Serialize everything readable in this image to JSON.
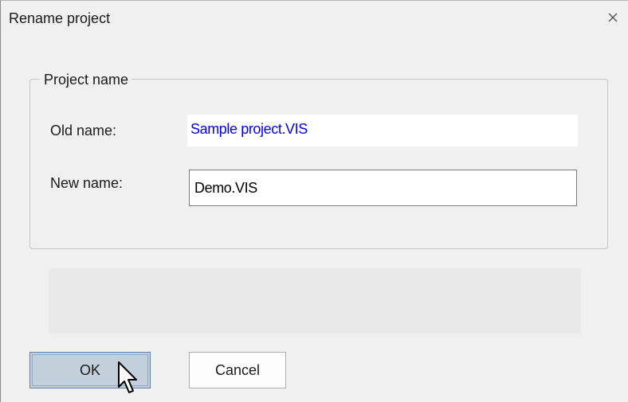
{
  "window": {
    "title": "Rename project",
    "close_glyph": "×"
  },
  "group": {
    "legend": "Project name",
    "old_name_label": "Old name:",
    "old_name_value": "Sample project.VIS",
    "new_name_label": "New name:",
    "new_name_value": "Demo.VIS"
  },
  "message_panel": {
    "text": ""
  },
  "buttons": {
    "ok_label": "OK",
    "cancel_label": "Cancel"
  },
  "colors": {
    "old_name_text": "#0000ff",
    "ok_button_bg": "#c3cfdb",
    "ok_button_border": "#5b83ad",
    "dialog_bg": "#f0f0f0"
  },
  "icons": {
    "close": "close-icon",
    "cursor": "mouse-pointer-icon"
  }
}
